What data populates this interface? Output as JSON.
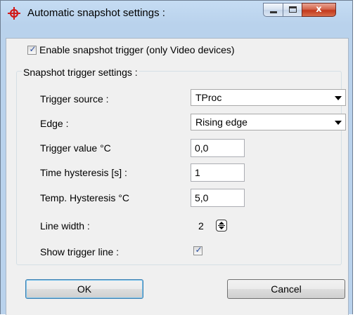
{
  "window": {
    "title": "Automatic snapshot settings :",
    "icon": "crosshair-icon",
    "controls": {
      "minimize": "minimize-icon",
      "maximize": "maximize-icon",
      "close": "x"
    }
  },
  "enable_trigger": {
    "label": "Enable snapshot trigger (only Video devices)",
    "checked": true
  },
  "group": {
    "title": "Snapshot trigger settings :",
    "trigger_source": {
      "label": "Trigger source :",
      "value": "TProc"
    },
    "edge": {
      "label": "Edge :",
      "value": "Rising edge"
    },
    "trigger_value": {
      "label": "Trigger value °C",
      "value": "0,0"
    },
    "time_hysteresis": {
      "label": "Time hysteresis [s] :",
      "value": "1"
    },
    "temp_hysteresis": {
      "label": "Temp. Hysteresis °C",
      "value": "5,0"
    },
    "line_width": {
      "label": "Line width :",
      "value": "2"
    },
    "show_trigger_line": {
      "label": "Show trigger line :",
      "checked": true
    }
  },
  "buttons": {
    "ok": "OK",
    "cancel": "Cancel"
  },
  "colors": {
    "accent": "#2a4ea0",
    "close_button": "#c2381c",
    "app_icon": "#d11a1a"
  }
}
